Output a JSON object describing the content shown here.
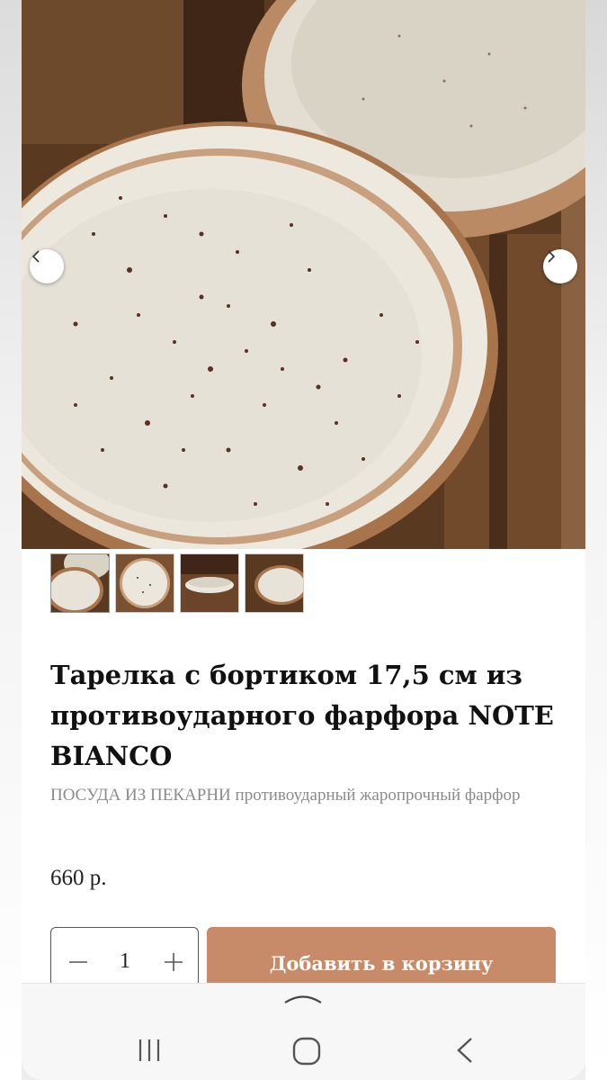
{
  "product": {
    "title": "Тарелка с бортиком 17,5 см из противоударного фарфора NOTE BIANCO",
    "subtitle": "ПОСУДА ИЗ ПЕКАРНИ противоударный жаропрочный фарфор",
    "price": "660 р."
  },
  "gallery": {
    "image_count": 4,
    "active_index": 0,
    "prev_icon": "chevron-left-icon",
    "next_icon": "chevron-right-icon"
  },
  "cart": {
    "quantity": "1",
    "add_label": "Добавить в корзину"
  },
  "system_nav": {
    "handle_icon": "chevron-up-icon",
    "recent_icon": "recent-apps-icon",
    "home_icon": "home-icon",
    "back_icon": "back-icon"
  },
  "colors": {
    "accent": "#c78b6a",
    "title": "#111111",
    "subtitle": "#8b8b8b"
  }
}
